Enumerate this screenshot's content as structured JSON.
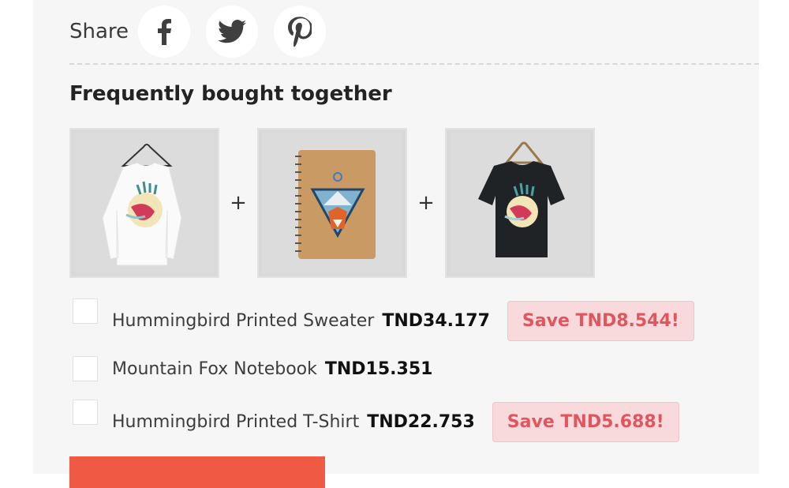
{
  "share": {
    "label": "Share",
    "icons": [
      "facebook-icon",
      "twitter-icon",
      "pinterest-icon"
    ]
  },
  "section": {
    "title": "Frequently bought together"
  },
  "thumbnails": [
    {
      "alt": "Hummingbird Printed Sweater",
      "image": "white-long-sleeve-shirt"
    },
    {
      "separator": "+"
    },
    {
      "alt": "Mountain Fox Notebook",
      "image": "kraft-notebook-fox"
    },
    {
      "separator": "+"
    },
    {
      "alt": "Hummingbird Printed T-Shirt",
      "image": "black-tshirt"
    }
  ],
  "separators": [
    "+",
    "+"
  ],
  "products": [
    {
      "name": "Hummingbird Printed Sweater",
      "price": "TND34.177",
      "save": "Save TND8.544!",
      "checked": false
    },
    {
      "name": "Mountain Fox Notebook",
      "price": "TND15.351",
      "save": "",
      "checked": false
    },
    {
      "name": "Hummingbird Printed T-Shirt",
      "price": "TND22.753",
      "save": "Save TND5.688!",
      "checked": false
    }
  ],
  "colors": {
    "panel": "#f6f6f6",
    "accent_button": "#ee5a44",
    "save_bg": "#f8dadc",
    "save_text": "#e0565e"
  }
}
